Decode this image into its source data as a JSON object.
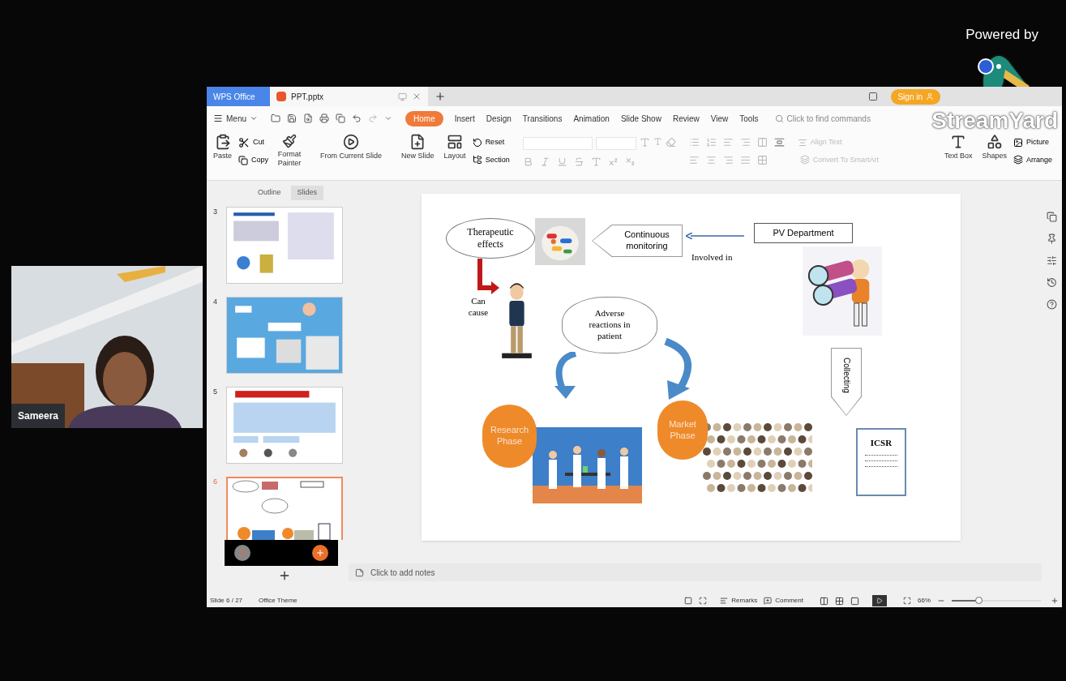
{
  "overlay": {
    "powered_by": "Powered by",
    "brand": "StreamYard"
  },
  "participant": {
    "name": "Sameera"
  },
  "window": {
    "tabs": [
      {
        "label": "WPS Office",
        "kind": "home",
        "selected": false
      },
      {
        "label": "PPT.pptx",
        "kind": "doc",
        "selected": true
      }
    ],
    "sign_in": "Sign in"
  },
  "menu": {
    "label": "Menu"
  },
  "ribbon_tabs": [
    {
      "label": "Home",
      "selected": true
    },
    {
      "label": "Insert",
      "selected": false
    },
    {
      "label": "Design",
      "selected": false
    },
    {
      "label": "Transitions",
      "selected": false
    },
    {
      "label": "Animation",
      "selected": false
    },
    {
      "label": "Slide Show",
      "selected": false
    },
    {
      "label": "Review",
      "selected": false
    },
    {
      "label": "View",
      "selected": false
    },
    {
      "label": "Tools",
      "selected": false
    }
  ],
  "search": {
    "placeholder": "Click to find commands"
  },
  "ribbon": {
    "paste": "Paste",
    "cut": "Cut",
    "copy": "Copy",
    "format_painter": "Format Painter",
    "from_current_slide": "From Current Slide",
    "new_slide": "New Slide",
    "layout": "Layout",
    "reset": "Reset",
    "section": "Section",
    "align_text": "Align Text",
    "convert_smartart": "Convert To SmartArt",
    "text_box": "Text Box",
    "shapes": "Shapes",
    "picture": "Picture",
    "arrange": "Arrange"
  },
  "panel_tabs": [
    {
      "label": "Outline",
      "selected": false
    },
    {
      "label": "Slides",
      "selected": true
    }
  ],
  "thumbnails": [
    {
      "number": "3",
      "kind": "text",
      "selected": false
    },
    {
      "number": "4",
      "kind": "collage",
      "selected": false
    },
    {
      "number": "5",
      "kind": "table",
      "selected": false
    },
    {
      "number": "6",
      "kind": "diagram",
      "selected": true
    }
  ],
  "slide": {
    "nodes": [
      {
        "kind": "ellipse",
        "text": "Therapeutic effects"
      },
      {
        "kind": "pointer",
        "text": "Continuous monitoring"
      },
      {
        "kind": "rect",
        "text": "PV Department"
      },
      {
        "kind": "label",
        "text": "Involved in"
      },
      {
        "kind": "label",
        "text": "Can cause"
      },
      {
        "kind": "cloud",
        "text": "Adverse reactions in patient"
      },
      {
        "kind": "circle",
        "text": "Research Phase"
      },
      {
        "kind": "circle",
        "text": "Market Phase"
      },
      {
        "kind": "down",
        "text": "Collecting"
      },
      {
        "kind": "report",
        "text": "ICSR"
      }
    ]
  },
  "notes": {
    "placeholder": "Click to add notes"
  },
  "status_bar": {
    "slide": "Slide 6 / 27",
    "theme": "Office Theme",
    "remarks": "Remarks",
    "comment": "Comment",
    "zoom": "66%",
    "level": 0.3
  }
}
